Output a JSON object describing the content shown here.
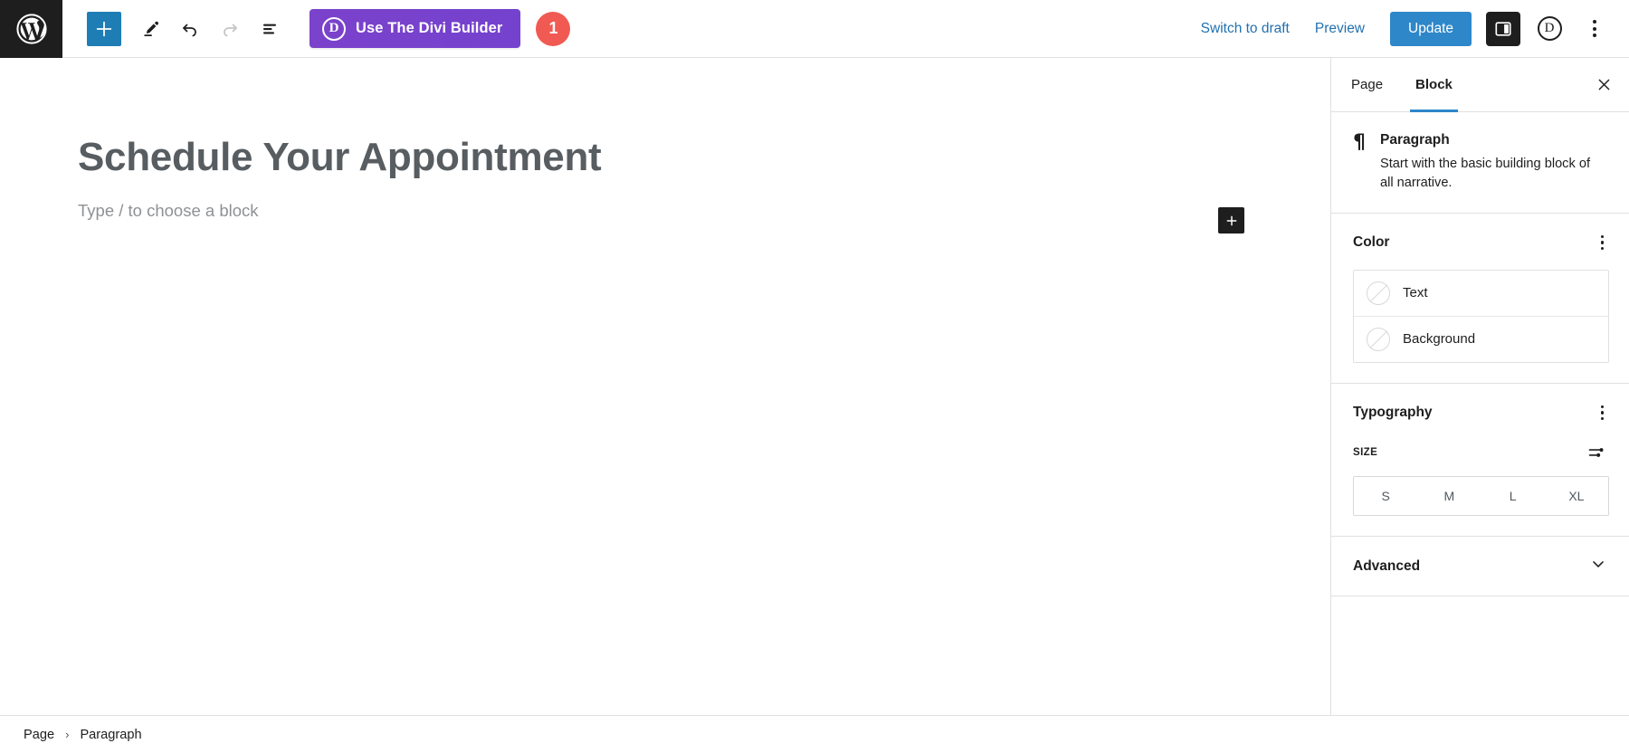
{
  "header": {
    "wp_logo": "wordpress-logo",
    "tools": [
      {
        "name": "add-block-button",
        "icon": "plus-icon",
        "label": "Add block"
      },
      {
        "name": "tools-button",
        "icon": "pencil-icon",
        "label": "Tools"
      },
      {
        "name": "undo-button",
        "icon": "undo-icon",
        "label": "Undo"
      },
      {
        "name": "redo-button",
        "icon": "redo-icon",
        "label": "Redo",
        "disabled": true
      },
      {
        "name": "list-view-button",
        "icon": "list-view-icon",
        "label": "Document overview"
      }
    ],
    "divi_button": {
      "mark": "D",
      "label": "Use The Divi Builder"
    },
    "notice_badge": "1",
    "switch_to_draft": "Switch to draft",
    "preview": "Preview",
    "update": "Update",
    "settings_toggle_icon": "sidebar-panel-icon",
    "divi_icon_mark": "D",
    "options_icon": "kebab-menu-icon",
    "accent_blue": "#2e87c9",
    "divi_purple": "#7B42CB",
    "badge_red": "#F05A52"
  },
  "canvas": {
    "post_title": "Schedule Your Appointment",
    "block_placeholder": "Type / to choose a block",
    "inserter_icon": "plus-icon"
  },
  "sidebar": {
    "tabs": [
      {
        "label": "Page",
        "active": false
      },
      {
        "label": "Block",
        "active": true
      }
    ],
    "close_icon": "close-icon",
    "block_card": {
      "icon": "paragraph-pilcrow-icon",
      "glyph": "¶",
      "title": "Paragraph",
      "description": "Start with the basic building block of all narrative."
    },
    "color": {
      "title": "Color",
      "options_icon": "kebab-menu-icon",
      "rows": [
        {
          "label": "Text",
          "swatch": "none"
        },
        {
          "label": "Background",
          "swatch": "none"
        }
      ]
    },
    "typography": {
      "title": "Typography",
      "options_icon": "kebab-menu-icon",
      "size_label": "SIZE",
      "size_settings_icon": "sliders-icon",
      "sizes": [
        "S",
        "M",
        "L",
        "XL"
      ],
      "selected_size": null
    },
    "advanced": {
      "title": "Advanced",
      "chevron_icon": "chevron-down-icon"
    }
  },
  "footer": {
    "breadcrumb": [
      {
        "label": "Page"
      },
      {
        "label": "Paragraph"
      }
    ],
    "separator": "›"
  }
}
